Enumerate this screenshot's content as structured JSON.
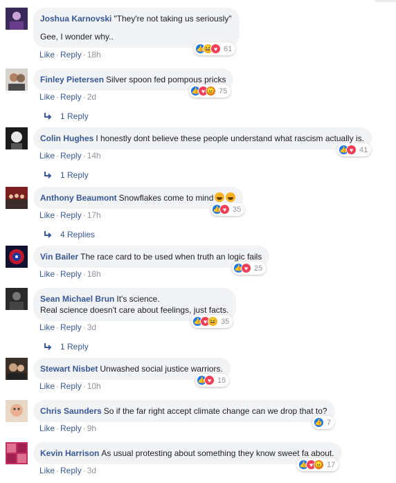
{
  "actions": {
    "like": "Like",
    "reply": "Reply",
    "dot": "·"
  },
  "comments": [
    {
      "author": "Joshua Karnovski",
      "text": "\"They're not taking us seriously\"",
      "text2": "Gee, I wonder why..",
      "reactions": [
        "like",
        "haha",
        "love"
      ],
      "count": "61",
      "time": "18h"
    },
    {
      "author": "Finley Pietersen",
      "text": "Silver spoon fed pompous pricks",
      "reactions": [
        "like",
        "love",
        "angry"
      ],
      "count": "75",
      "time": "2d",
      "replies": "1 Reply"
    },
    {
      "author": "Colin Hughes",
      "text": "I honestly dont believe these people understand what rascism actually is.",
      "reactions": [
        "like",
        "love"
      ],
      "count": "41",
      "time": "14h",
      "replies": "1 Reply"
    },
    {
      "author": "Anthony Beaumont",
      "text": "Snowflakes come to mind",
      "emoji": [
        "rofl-emoji",
        "rofl-emoji"
      ],
      "reactions": [
        "like",
        "love"
      ],
      "count": "35",
      "time": "17h",
      "replies": "4 Replies"
    },
    {
      "author": "Vin Bailer",
      "text": "The race card to be used when truth an logic fails",
      "reactions": [
        "like",
        "love"
      ],
      "count": "25",
      "time": "18h"
    },
    {
      "author": "Sean Michael Brun",
      "text": "It's science.",
      "text2": "Real science doesn't care about feelings, just facts.",
      "reactions": [
        "like",
        "love",
        "haha"
      ],
      "count": "35",
      "time": "3d",
      "replies": "1 Reply"
    },
    {
      "author": "Stewart Nisbet",
      "text": "Unwashed social justice warriors.",
      "reactions": [
        "like",
        "love"
      ],
      "count": "15",
      "time": "10h"
    },
    {
      "author": "Chris Saunders",
      "text": "So if the far right accept climate change can we drop that to?",
      "reactions": [
        "like"
      ],
      "count": "7",
      "time": "9h"
    },
    {
      "author": "Kevin Harrison",
      "text": "As usual protesting about something they know sweet fa about.",
      "reactions": [
        "like",
        "love",
        "angry"
      ],
      "count": "17",
      "time": "3d"
    }
  ],
  "colors": {
    "link": "#385898",
    "bubble": "#f2f3f5",
    "like": "#1877f2",
    "love": "#f33e58",
    "haha": "#f7b125",
    "angry": "#e9710f"
  }
}
